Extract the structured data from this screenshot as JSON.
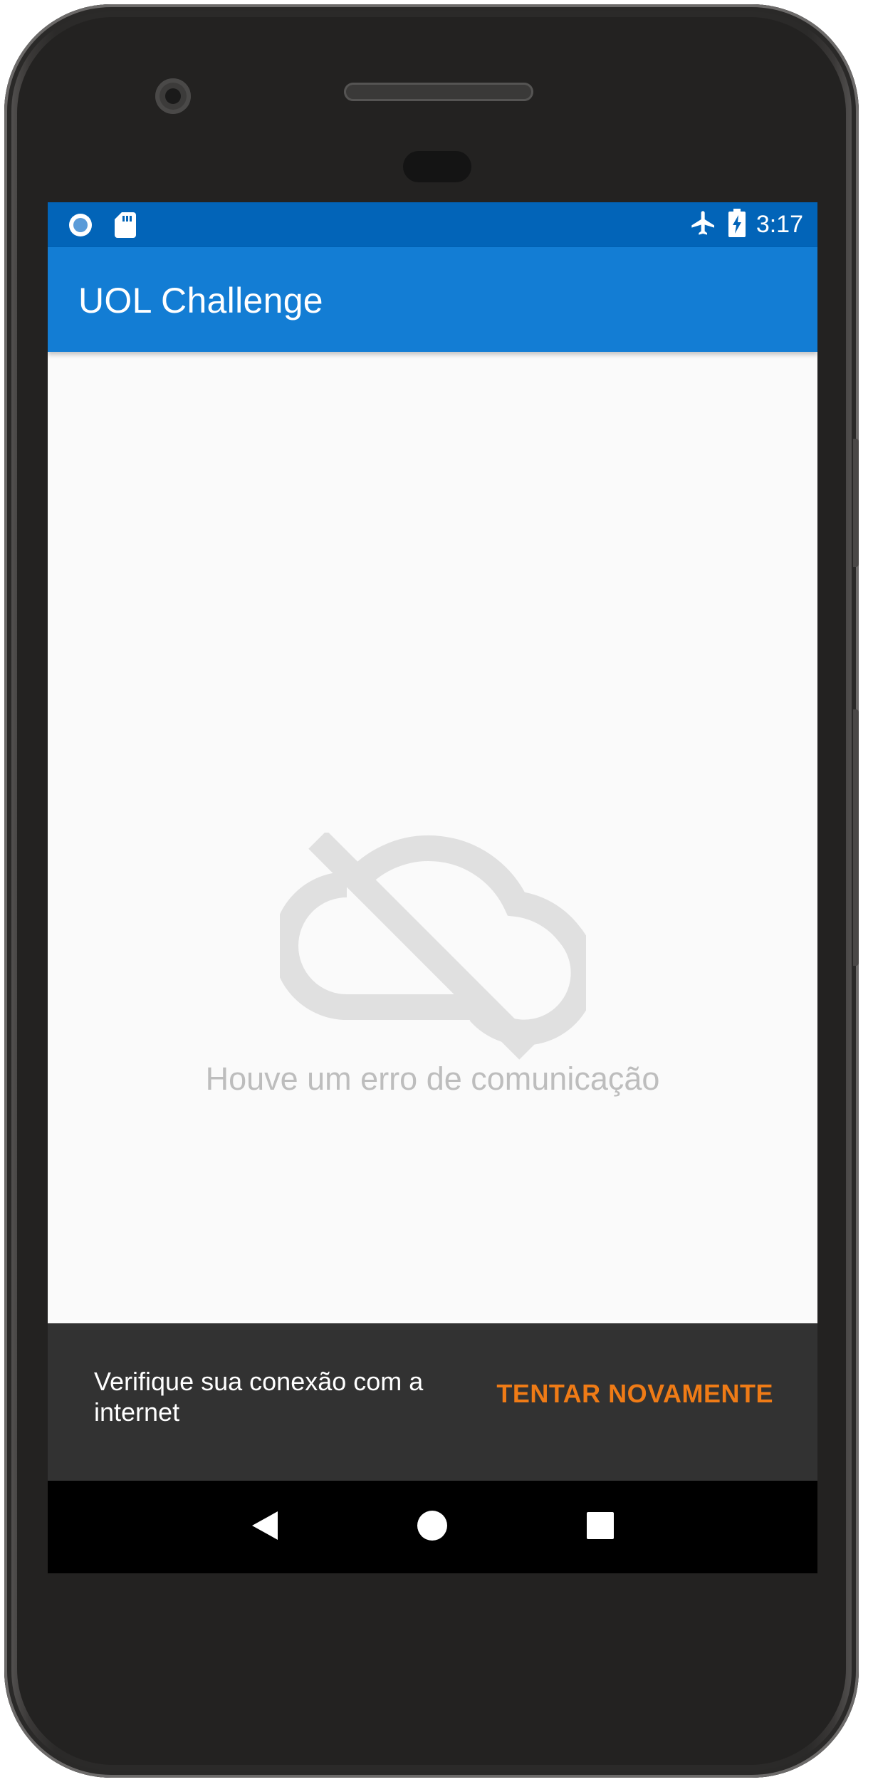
{
  "status_bar": {
    "time": "3:17",
    "left_icons": [
      "record-icon",
      "sd-card-icon"
    ],
    "right_icons": [
      "airplane-icon",
      "battery-charging-icon"
    ]
  },
  "app_bar": {
    "title": "UOL Challenge"
  },
  "content": {
    "icon": "cloud-off-icon",
    "message": "Houve um erro de comunicação"
  },
  "snackbar": {
    "message": "Verifique sua conexão com a internet",
    "action_label": "TENTAR NOVAMENTE"
  },
  "nav_bar": {
    "buttons": [
      "back-icon",
      "home-icon",
      "recents-icon"
    ]
  },
  "colors": {
    "status_bar": "#0264b8",
    "app_bar": "#137dd4",
    "background": "#fafafa",
    "error_text": "#bdbdbd",
    "icon": "#e0e0e0",
    "snackbar_bg": "#323232",
    "snackbar_action": "#ef7b16"
  }
}
